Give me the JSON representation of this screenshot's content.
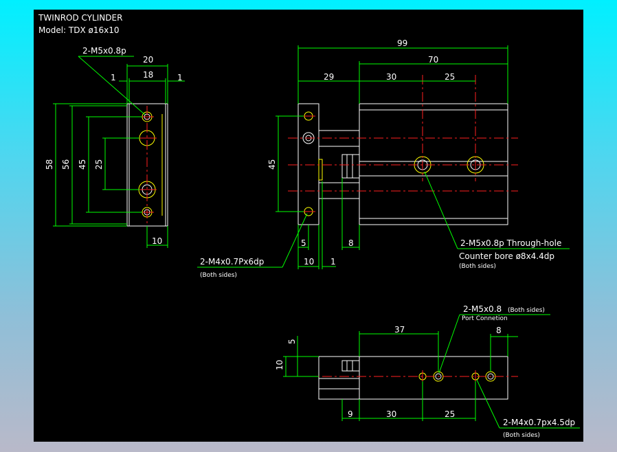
{
  "title": {
    "line1": "TWINROD CYLINDER",
    "line2": "Model: TDX  ø16x10"
  },
  "left_view": {
    "callout": "2-M5x0.8p",
    "dims": {
      "width_20": "20",
      "width_18": "18",
      "side_1_left": "1",
      "side_1_right": "1",
      "h58": "58",
      "h56": "56",
      "h45": "45",
      "h25": "25",
      "bottom_10": "10"
    }
  },
  "front_view": {
    "dims": {
      "d99": "99",
      "d70": "70",
      "d29": "29",
      "d30": "30",
      "d25": "25",
      "d45": "45",
      "d5": "5",
      "d8": "8",
      "d10": "10",
      "d1": "1"
    },
    "callout_left": {
      "text": "2-M4x0.7Px6dp",
      "sub": "(Both sides)"
    },
    "callout_right": {
      "text": "2-M5x0.8p Through-hole",
      "text2": "Counter bore ø8x4.4dp",
      "sub": "(Both sides)"
    }
  },
  "bottom_view": {
    "dims": {
      "d37": "37",
      "d8": "8",
      "d5": "5",
      "d10": "10",
      "d9": "9",
      "d30": "30",
      "d25": "25"
    },
    "callout_top": {
      "text": "2-M5x0.8",
      "text_sub": "(Both sides)",
      "line2": "Port Connetion"
    },
    "callout_bottom": {
      "text": "2-M4x0.7px4.5dp",
      "sub": "(Both sides)"
    }
  },
  "colors": {
    "dimension": "#00ff00",
    "outline": "#ffffff",
    "centerline": "#ff2020",
    "hidden": "#ffff00",
    "background": "#000000",
    "page_gradient_top": "#00f0ff",
    "page_gradient_bottom": "#b9b9c9"
  }
}
